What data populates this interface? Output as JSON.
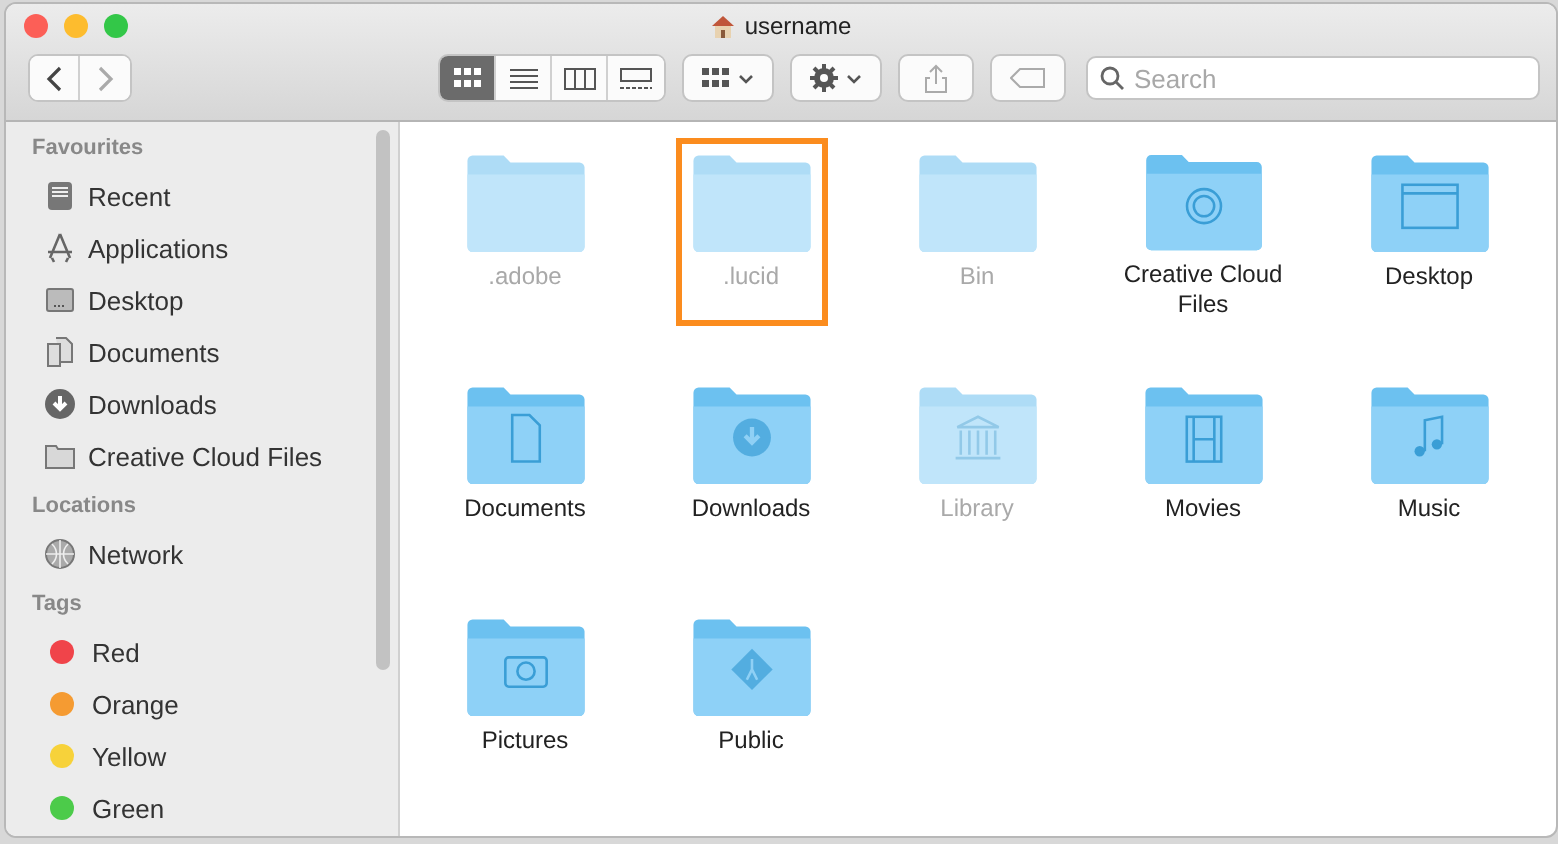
{
  "window": {
    "title": "username"
  },
  "toolbar": {
    "view_modes": [
      {
        "kind": "icons",
        "selected": true
      },
      {
        "kind": "list",
        "selected": false
      },
      {
        "kind": "columns",
        "selected": false
      },
      {
        "kind": "gallery",
        "selected": false
      }
    ],
    "search": {
      "placeholder": "Search"
    }
  },
  "sidebar": {
    "sections": [
      {
        "title": "Favourites",
        "items": [
          {
            "label": "Recent",
            "kind": "recent"
          },
          {
            "label": "Applications",
            "kind": "apps"
          },
          {
            "label": "Desktop",
            "kind": "desktop"
          },
          {
            "label": "Documents",
            "kind": "documents"
          },
          {
            "label": "Downloads",
            "kind": "downloads"
          },
          {
            "label": "Creative Cloud Files",
            "kind": "folder"
          }
        ]
      },
      {
        "title": "Locations",
        "items": [
          {
            "label": "Network",
            "kind": "network"
          }
        ]
      },
      {
        "title": "Tags",
        "items": [
          {
            "label": "Red",
            "kind": "tag",
            "color": "#f0444a"
          },
          {
            "label": "Orange",
            "kind": "tag",
            "color": "#f59b32"
          },
          {
            "label": "Yellow",
            "kind": "tag",
            "color": "#f7d23a"
          },
          {
            "label": "Green",
            "kind": "tag",
            "color": "#4ccb4a"
          }
        ]
      }
    ]
  },
  "files": [
    {
      "name": ".adobe",
      "kind": "plain",
      "dimmed": true,
      "highlighted": false
    },
    {
      "name": ".lucid",
      "kind": "plain",
      "dimmed": true,
      "highlighted": true
    },
    {
      "name": "Bin",
      "kind": "plain",
      "dimmed": true,
      "highlighted": false
    },
    {
      "name": "Creative Cloud Files",
      "kind": "cloud",
      "dimmed": false,
      "highlighted": false
    },
    {
      "name": "Desktop",
      "kind": "window",
      "dimmed": false,
      "highlighted": false
    },
    {
      "name": "Documents",
      "kind": "document",
      "dimmed": false,
      "highlighted": false
    },
    {
      "name": "Downloads",
      "kind": "download",
      "dimmed": false,
      "highlighted": false
    },
    {
      "name": "Library",
      "kind": "library",
      "dimmed": true,
      "highlighted": false
    },
    {
      "name": "Movies",
      "kind": "film",
      "dimmed": false,
      "highlighted": false
    },
    {
      "name": "Music",
      "kind": "music",
      "dimmed": false,
      "highlighted": false
    },
    {
      "name": "Pictures",
      "kind": "camera",
      "dimmed": false,
      "highlighted": false
    },
    {
      "name": "Public",
      "kind": "public",
      "dimmed": false,
      "highlighted": false
    }
  ]
}
